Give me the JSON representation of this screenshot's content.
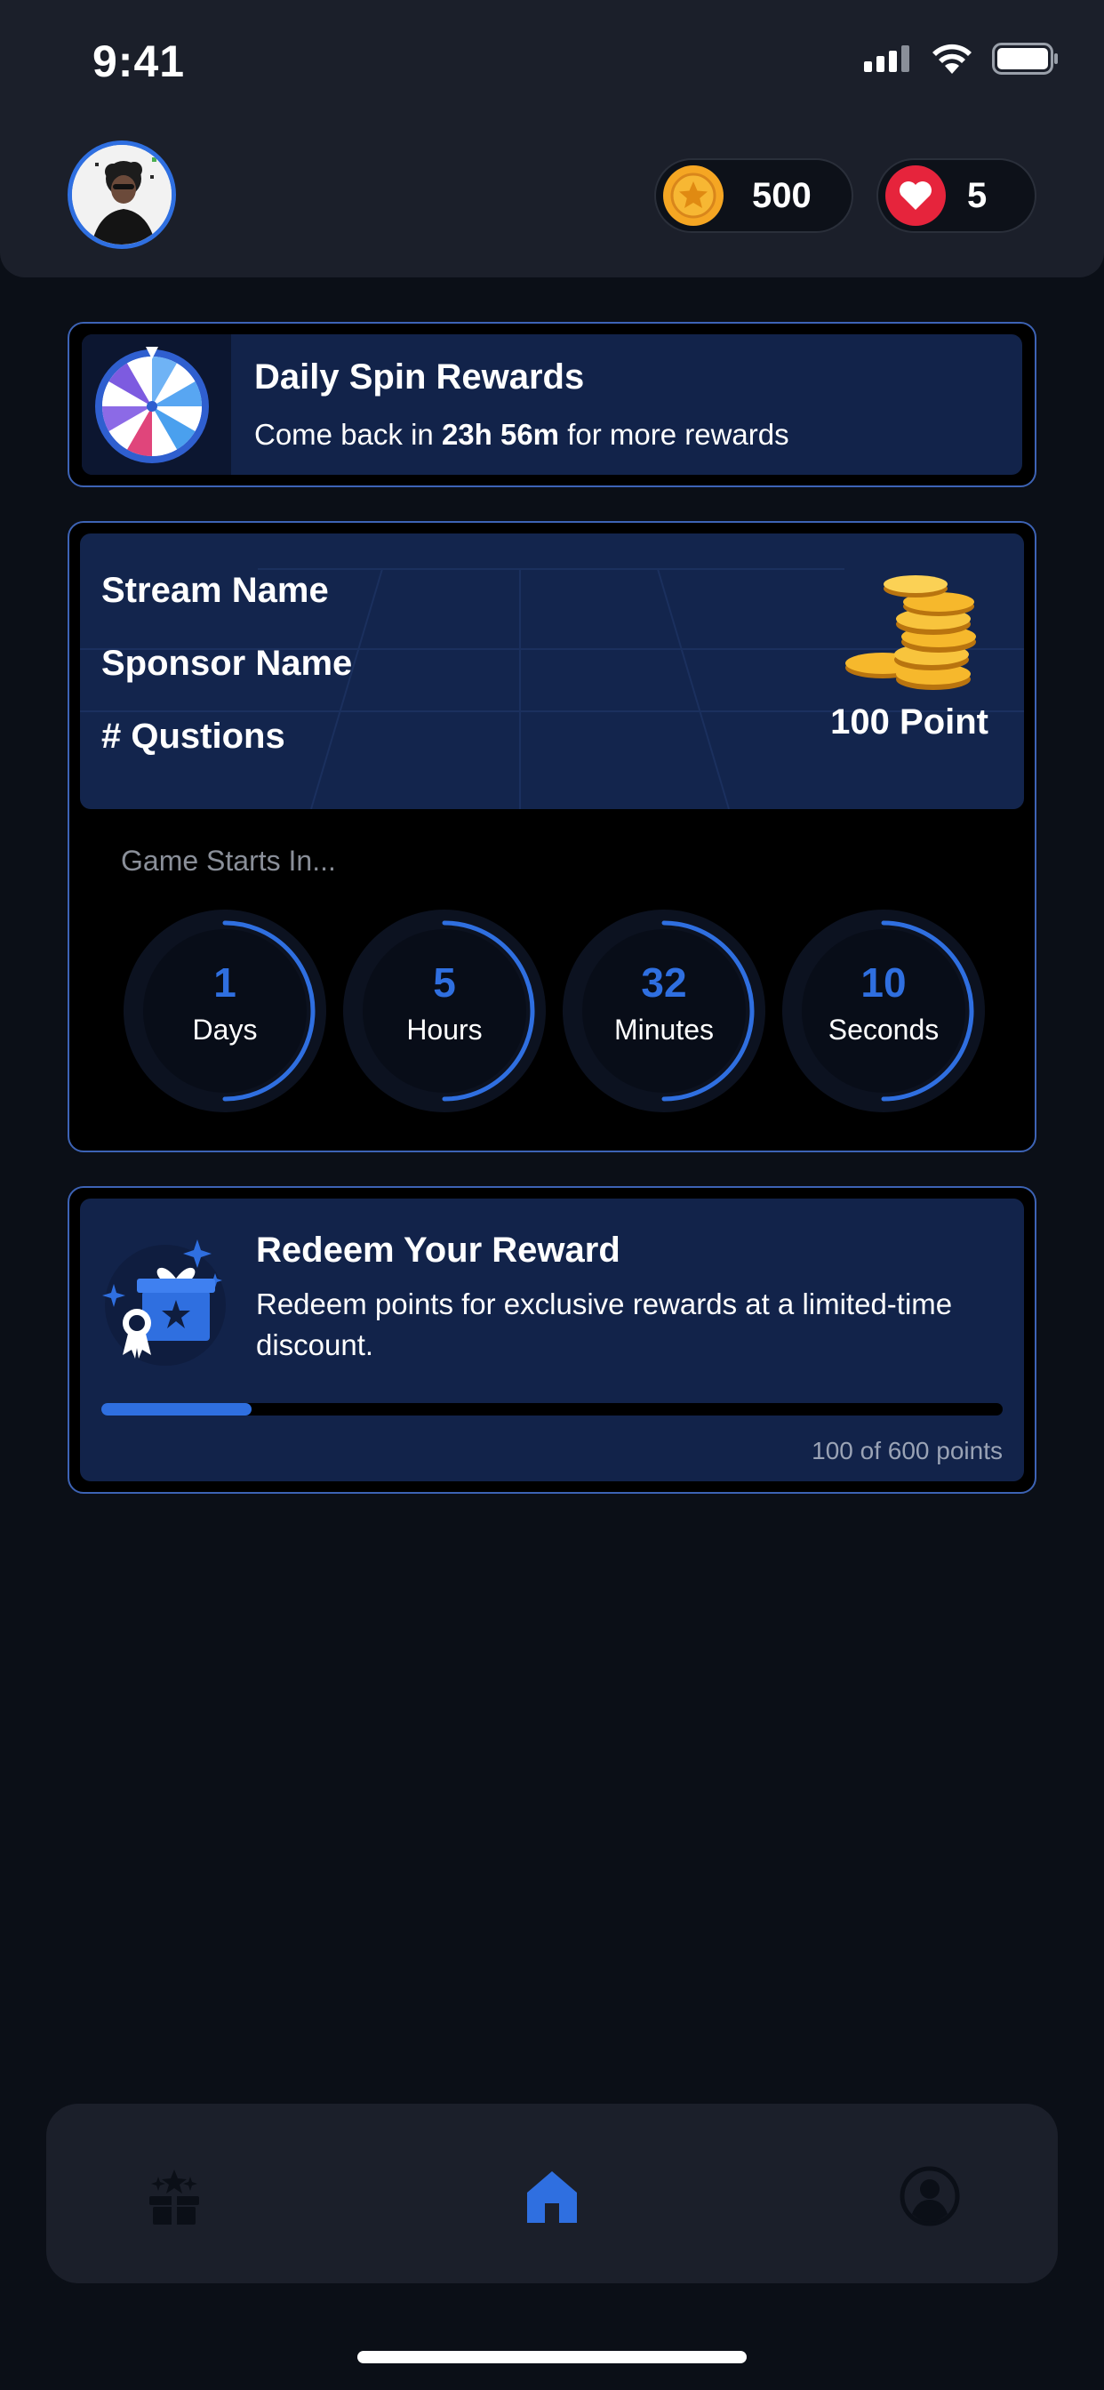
{
  "status_bar": {
    "time": "9:41"
  },
  "header": {
    "coins": "500",
    "lives": "5"
  },
  "daily_spin": {
    "title": "Daily Spin Rewards",
    "sub_prefix": "Come back in ",
    "sub_time": "23h 56m",
    "sub_suffix": " for more rewards"
  },
  "game": {
    "stream_name": "Stream Name",
    "sponsor_name": "Sponsor Name",
    "questions": "# Qustions",
    "points": "100 Point",
    "starts_label": "Game Starts In...",
    "timers": [
      {
        "value": "1",
        "unit": "Days"
      },
      {
        "value": "5",
        "unit": "Hours"
      },
      {
        "value": "32",
        "unit": "Minutes"
      },
      {
        "value": "10",
        "unit": "Seconds"
      }
    ]
  },
  "redeem": {
    "title": "Redeem Your Reward",
    "description": "Redeem points for exclusive rewards at a limited-time discount.",
    "progress_fraction": 0.1667,
    "progress_text": "100 of 600 points"
  },
  "nav": {
    "items": [
      {
        "icon": "gift-icon",
        "active": false
      },
      {
        "icon": "home-icon",
        "active": true
      },
      {
        "icon": "profile-icon",
        "active": false
      }
    ]
  },
  "colors": {
    "accent": "#2f6fe0",
    "card_bg": "#12234a",
    "page_bg": "#0b0f17"
  }
}
